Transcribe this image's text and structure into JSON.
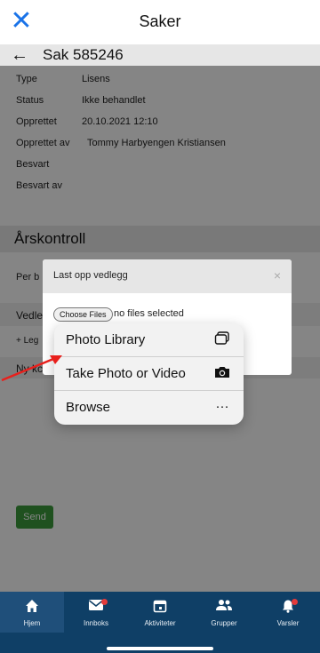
{
  "header": {
    "title": "Saker",
    "close_icon": "close-icon"
  },
  "case": {
    "title": "Sak 585246",
    "back_icon": "back-arrow-icon"
  },
  "info_rows": [
    {
      "label": "Type",
      "value": "Lisens"
    },
    {
      "label": "Status",
      "value": "Ikke behandlet"
    },
    {
      "label": "Opprettet",
      "value": "20.10.2021 12:10"
    },
    {
      "label": "Opprettet av",
      "value": "Tommy Harbyengen Kristiansen"
    },
    {
      "label": "Besvart",
      "value": ""
    },
    {
      "label": "Besvart av",
      "value": ""
    }
  ],
  "section": {
    "title": "Årskontroll"
  },
  "partial_labels": {
    "per": "Per b",
    "vedlegg": "Vedle",
    "legg": "+ Leg",
    "ny": "Ny kc"
  },
  "send_label": "Send",
  "modal": {
    "title": "Last opp vedlegg",
    "close": "×",
    "choose_files": "Choose Files",
    "no_files": "no files selected"
  },
  "picker_menu": {
    "items": [
      {
        "label": "Photo Library",
        "icon": "photo-library-icon"
      },
      {
        "label": "Take Photo or Video",
        "icon": "camera-icon"
      },
      {
        "label": "Browse",
        "icon": "more-icon"
      }
    ]
  },
  "bottom_nav": {
    "items": [
      {
        "label": "Hjem",
        "icon": "home-icon",
        "active": true
      },
      {
        "label": "Innboks",
        "icon": "mail-icon",
        "badge": true
      },
      {
        "label": "Aktiviteter",
        "icon": "calendar-icon"
      },
      {
        "label": "Grupper",
        "icon": "group-icon"
      },
      {
        "label": "Varsler",
        "icon": "bell-icon",
        "badge": true
      }
    ]
  },
  "colors": {
    "accent": "#1a73e8",
    "nav_bg": "#0f3f66",
    "send_green": "#3c9b3c",
    "badge_red": "#e23b3b",
    "annotation_arrow": "#e8201c"
  }
}
